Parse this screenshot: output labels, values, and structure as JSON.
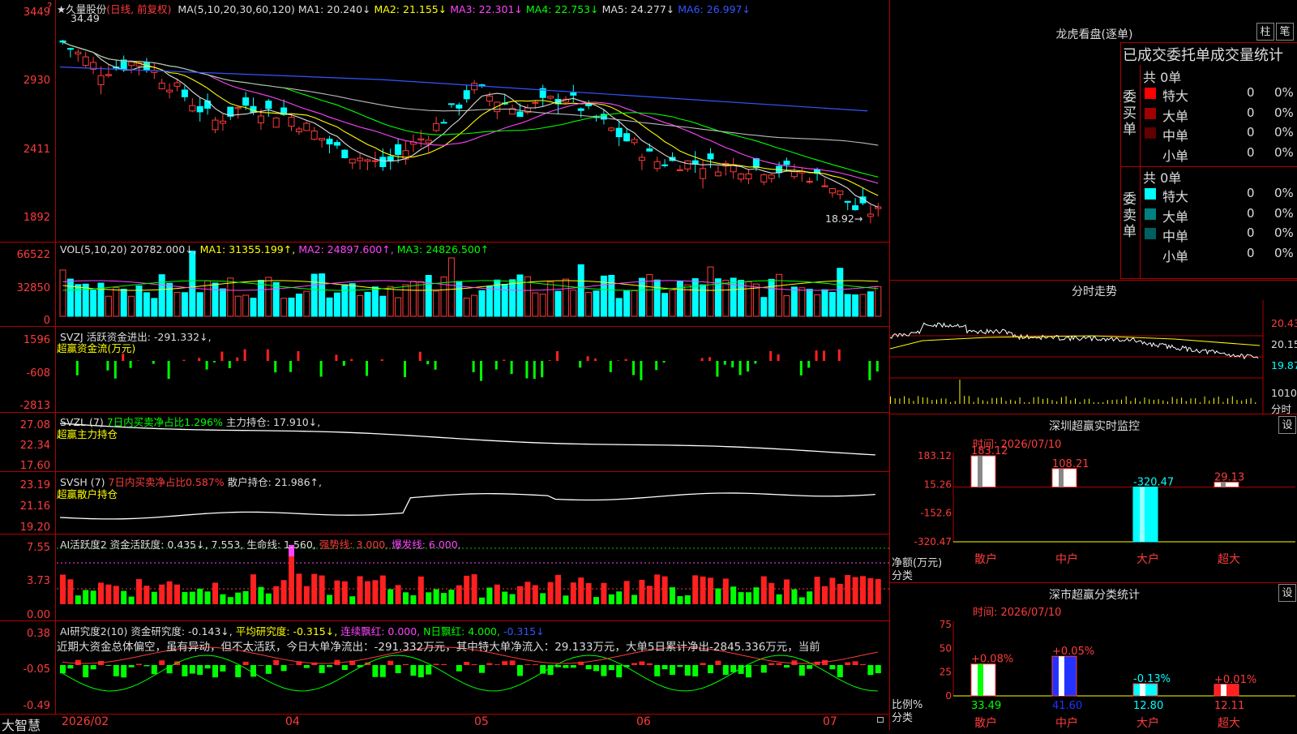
{
  "stock": {
    "name": "久量股份",
    "mode": "(日线, 前复权)",
    "question_mark": "?"
  },
  "ma_header": [
    {
      "text": "MA(5,10,20,30,60,120)",
      "color": "#dddddd"
    },
    {
      "text": "MA1: 20.240↓",
      "color": "#dddddd"
    },
    {
      "text": "MA2: 21.155↓",
      "color": "#ffff00"
    },
    {
      "text": "MA3: 22.301↓",
      "color": "#ff44ff"
    },
    {
      "text": "MA4: 22.753↓",
      "color": "#00ff00"
    },
    {
      "text": "MA5: 24.277↓",
      "color": "#dddddd"
    },
    {
      "text": "MA6: 26.997↓",
      "color": "#3355ff"
    }
  ],
  "price_axis": [
    "3449",
    "2930",
    "2411",
    "1892"
  ],
  "price_high_label": "34.49",
  "price_low_label": "18.92",
  "vol_axis": [
    "66522",
    "32850",
    "0"
  ],
  "vol_header": [
    {
      "text": "VOL(5,10,20)",
      "color": "#dddddd"
    },
    {
      "text": "20782.000↓,",
      "color": "#dddddd"
    },
    {
      "text": "MA1: 31355.199↑,",
      "color": "#ffff00"
    },
    {
      "text": "MA2: 24897.600↑,",
      "color": "#ff44ff"
    },
    {
      "text": "MA3: 24826.500↑",
      "color": "#00ff00"
    }
  ],
  "svzj_axis": [
    "1596",
    "-608",
    "-2813"
  ],
  "svzj_header": [
    {
      "text": "SVZJ  活跃资金进出: -291.332↓,",
      "color": "#dddddd"
    }
  ],
  "svzj_sub": "超赢资金流(万元)",
  "svzl_axis": [
    "27.08",
    "22.34",
    "17.60"
  ],
  "svzl_header": [
    {
      "text": "SVZL (7)",
      "color": "#dddddd"
    },
    {
      "text": "7日内买卖净占比1.296%",
      "color": "#00ff00"
    },
    {
      "text": "主力持仓: 17.910↓,",
      "color": "#dddddd"
    }
  ],
  "svzl_sub": "超赢主力持仓",
  "svsh_axis": [
    "23.19",
    "21.16",
    "19.20"
  ],
  "svsh_header": [
    {
      "text": "SVSH (7)",
      "color": "#dddddd"
    },
    {
      "text": "7日内买卖净占比0.587%",
      "color": "#ff3b3b"
    },
    {
      "text": "散户持仓: 21.986↑,",
      "color": "#dddddd"
    }
  ],
  "svsh_sub": "超赢散户持仓",
  "ai_axis": [
    "7.55",
    "3.73",
    "0.00"
  ],
  "ai_header": [
    {
      "text": "AI活跃度2 资金活跃度: 0.435↓, 7.553,",
      "color": "#dddddd"
    },
    {
      "text": "生命线: 1.560,",
      "color": "#dddddd"
    },
    {
      "text": "强势线: 3.000,",
      "color": "#ff3b3b"
    },
    {
      "text": "爆发线: 6.000,",
      "color": "#ff44ff"
    }
  ],
  "yj_axis": [
    "0.38",
    "-0.05",
    "-0.49"
  ],
  "yj_header": [
    {
      "text": "AI研究度2(10) 资金研究度: -0.143↓,",
      "color": "#dddddd"
    },
    {
      "text": "平均研究度: -0.315↓,",
      "color": "#ffff00"
    },
    {
      "text": "连续飘红: 0.000,",
      "color": "#ff44ff"
    },
    {
      "text": "N日飘红: 4.000,",
      "color": "#00ff00"
    },
    {
      "text": "-0.315↓",
      "color": "#3355ff"
    }
  ],
  "yj_comment": "近期大资金总体偏空，虽有异动，但不太活跃，今日大单净流出：-291.332万元，其中特大单净流入：29.133万元，大单5日累计净出-2845.336万元，当前",
  "footer": {
    "brand": "大智慧",
    "months": [
      "2026/02",
      "04",
      "05",
      "06",
      "07"
    ]
  },
  "right": {
    "longhu_title": "龙虎看盘(逐单)",
    "btn_zhu": "柱",
    "btn_bi": "笔",
    "sub_title": "已成交委托单成交量统计",
    "buy_side": "委买单",
    "sell_side": "委卖单",
    "buy_total": "共 0单",
    "sell_total": "共 0单",
    "buy_rows": [
      {
        "label": "特大",
        "count": "0",
        "pct": "0%",
        "color": "#ff0000"
      },
      {
        "label": "大单",
        "count": "0",
        "pct": "0%",
        "color": "#a00000"
      },
      {
        "label": "中单",
        "count": "0",
        "pct": "0%",
        "color": "#600000"
      },
      {
        "label": "小单",
        "count": "0",
        "pct": "0%",
        "color": "#000000"
      }
    ],
    "sell_rows": [
      {
        "label": "特大",
        "count": "0",
        "pct": "0%",
        "color": "#00ffff"
      },
      {
        "label": "大单",
        "count": "0",
        "pct": "0%",
        "color": "#008080"
      },
      {
        "label": "中单",
        "count": "0",
        "pct": "0%",
        "color": "#006060"
      },
      {
        "label": "小单",
        "count": "0",
        "pct": "0%",
        "color": "#000000"
      }
    ],
    "fenshi_title": "分时走势",
    "fenshi_axis": [
      "20.43",
      "20.15",
      "19.87"
    ],
    "fenshi_vol": "1010",
    "fenshi_label": "分时",
    "sz_title": "深圳超赢实时监控",
    "sz_btn": "设",
    "sz_time": "时间: 2026/07/10",
    "sz_axis": [
      "183.12",
      "15.26",
      "-152.6",
      "-320.47"
    ],
    "sz_unit": "净额(万元)",
    "sz_class": "分类",
    "sz_cats": [
      "散户",
      "中户",
      "大户",
      "超大"
    ],
    "sz_labels": [
      "183.12",
      "108.21",
      "-320.47",
      "29.13"
    ],
    "fl_title": "深市超赢分类统计",
    "fl_btn": "设",
    "fl_time": "时间: 2026/07/10",
    "fl_axis": [
      "75",
      "50",
      "25",
      "0"
    ],
    "fl_unit": "比例%",
    "fl_class": "分类",
    "fl_top": [
      "+0.08%",
      "+0.05%",
      "-0.13%",
      "+0.01%"
    ],
    "fl_bottom": [
      "33.49",
      "41.60",
      "12.80",
      "12.11"
    ],
    "fl_cats": [
      "散户",
      "中户",
      "大户",
      "超大"
    ]
  },
  "chart_data": [
    {
      "type": "line",
      "title": "深圳超赢实时监控",
      "categories": [
        "散户",
        "中户",
        "大户",
        "超大"
      ],
      "values": [
        183.12,
        108.21,
        -320.47,
        29.13
      ],
      "ylabel": "净额(万元)",
      "ylim": [
        -320.47,
        183.12
      ]
    },
    {
      "type": "bar",
      "title": "深市超赢分类统计",
      "categories": [
        "散户",
        "中户",
        "大户",
        "超大"
      ],
      "values": [
        33.49,
        41.6,
        12.8,
        12.11
      ],
      "ylabel": "比例%",
      "ylim": [
        0,
        75
      ]
    }
  ]
}
